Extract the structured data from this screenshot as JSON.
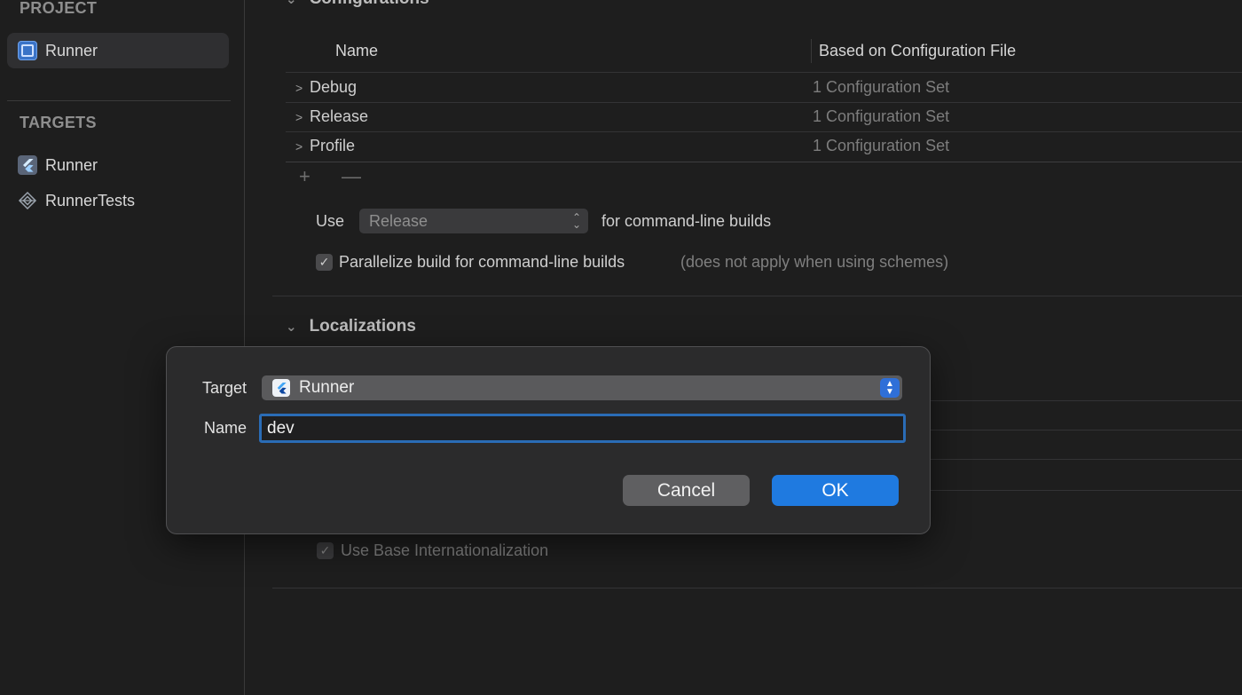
{
  "sidebar": {
    "project_header": "PROJECT",
    "project_items": [
      {
        "label": "Runner",
        "icon": "app-icon"
      }
    ],
    "targets_header": "TARGETS",
    "target_items": [
      {
        "label": "Runner",
        "icon": "flutter-icon"
      },
      {
        "label": "RunnerTests",
        "icon": "test-bundle-icon"
      }
    ]
  },
  "configurations": {
    "section_title": "Configurations",
    "columns": [
      "Name",
      "Based on Configuration File"
    ],
    "rows": [
      {
        "name": "Debug",
        "value": "1 Configuration Set"
      },
      {
        "name": "Release",
        "value": "1 Configuration Set"
      },
      {
        "name": "Profile",
        "value": "1 Configuration Set"
      }
    ],
    "use_label": "Use",
    "use_select_value": "Release",
    "use_suffix": "for command-line builds",
    "parallelize_label": "Parallelize build for command-line builds",
    "parallelize_note": "(does not apply when using schemes)"
  },
  "localizations": {
    "section_title": "Localizations",
    "base_intl_label": "Use Base Internationalization"
  },
  "dialog": {
    "target_label": "Target",
    "target_value": "Runner",
    "name_label": "Name",
    "name_value": "dev",
    "cancel_label": "Cancel",
    "ok_label": "OK"
  },
  "colors": {
    "accent": "#1f7ae0",
    "focus_ring": "#2a6cb6",
    "background": "#1e1e1e"
  }
}
